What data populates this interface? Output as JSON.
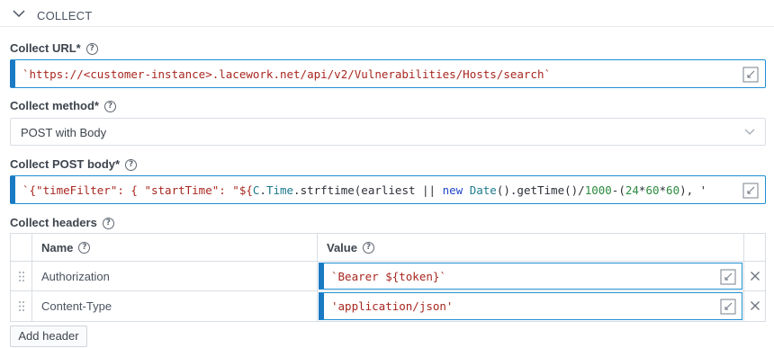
{
  "section": {
    "title": "COLLECT"
  },
  "collect_url": {
    "label": "Collect URL*",
    "value": "`https://<customer-instance>.lacework.net/api/v2/Vulnerabilities/Hosts/search`"
  },
  "collect_method": {
    "label": "Collect method*",
    "value": "POST with Body"
  },
  "collect_post_body": {
    "label": "Collect POST body*",
    "parts": {
      "p1": "`{\"timeFilter\": { \"startTime\": \"${",
      "p2": "C",
      "p3": ".",
      "p4": "Time",
      "p5": ".strftime(earliest || ",
      "p6": "new",
      "p7": " ",
      "p8": "Date",
      "p9": "().getTime()/",
      "p10": "1000",
      "p11": "-(",
      "p12": "24",
      "p13": "*",
      "p14": "60",
      "p15": "*",
      "p16": "60",
      "p17": "), '"
    }
  },
  "collect_headers": {
    "label": "Collect headers",
    "columns": {
      "name": "Name",
      "value": "Value"
    },
    "rows": [
      {
        "name": "Authorization",
        "value": "`Bearer ${token}`"
      },
      {
        "name": "Content-Type",
        "value": "'application/json'"
      }
    ],
    "add_label": "Add header"
  },
  "colors": {
    "accent": "#1a7ac3",
    "string": "#a8271f",
    "keyword": "#1f45c8",
    "number": "#2b8a3e"
  },
  "icons": {
    "section_toggle": "chevron-down-icon",
    "help": "help-circle-icon",
    "expand": "expand-editor-icon",
    "drag": "drag-handle-icon",
    "remove": "close-icon"
  }
}
